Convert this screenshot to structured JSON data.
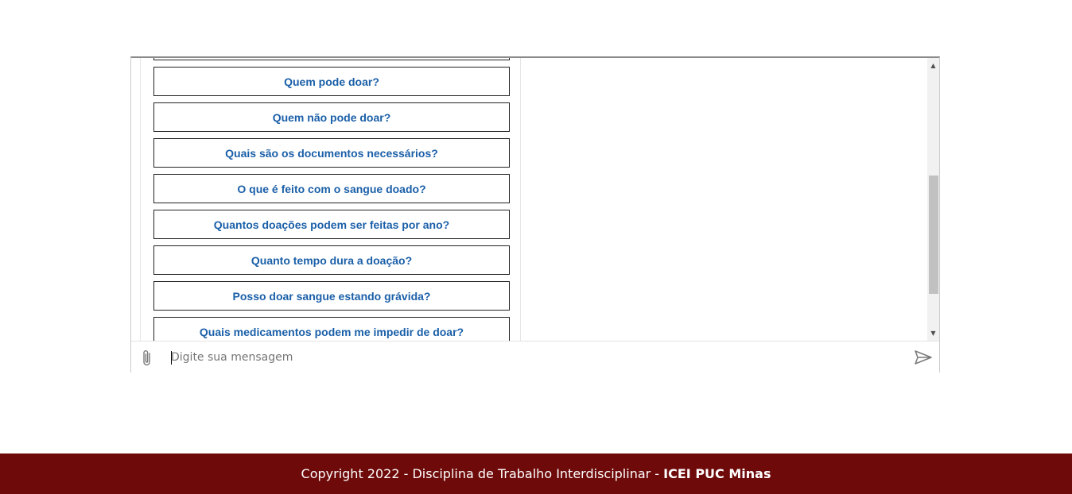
{
  "chat": {
    "options": [
      {
        "label": "Quem pode doar?"
      },
      {
        "label": "Quem não pode doar?"
      },
      {
        "label": "Quais são os documentos necessários?"
      },
      {
        "label": "O que é feito com o sangue doado?"
      },
      {
        "label": "Quantos doações podem ser feitas por ano?"
      },
      {
        "label": "Quanto tempo dura a doação?"
      },
      {
        "label": "Posso doar sangue estando grávida?"
      },
      {
        "label": "Quais medicamentos podem me impedir de doar?"
      }
    ],
    "input": {
      "value": "",
      "placeholder": "Digite sua mensagem"
    },
    "icons": {
      "attach": "paperclip-icon",
      "send": "send-icon",
      "scroll_up": "scroll-up-arrow",
      "scroll_down": "scroll-down-arrow"
    }
  },
  "footer": {
    "text": "Copyright 2022 - Disciplina de Trabalho Interdisciplinar - ",
    "emphasis": "ICEI PUC Minas",
    "background": "#6e0a0a"
  },
  "colors": {
    "option_text": "#1a5fa8",
    "option_border": "#222222"
  }
}
